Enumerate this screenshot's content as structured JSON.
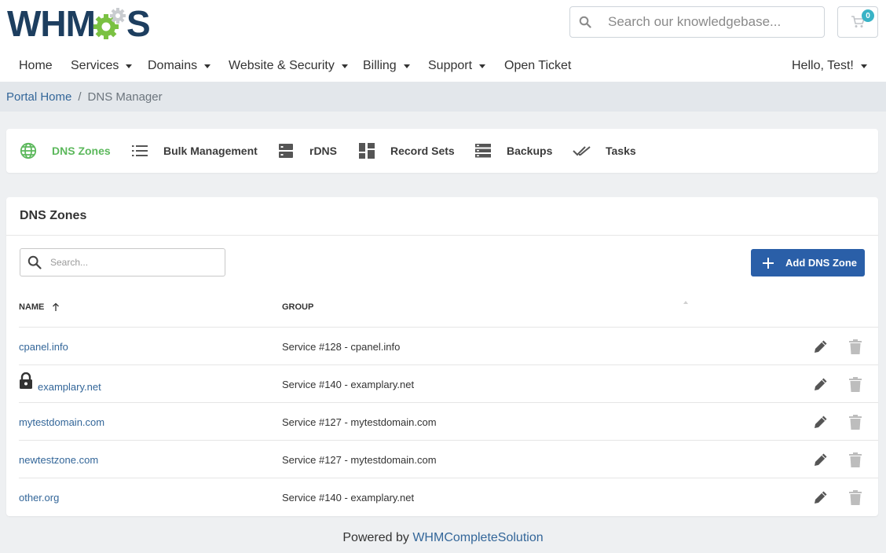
{
  "brand": {
    "logo_text_left": "WHM",
    "logo_text_right": "S",
    "colors": {
      "navy": "#1d3e5f",
      "green": "#7ac142",
      "link": "#336699",
      "primary": "#2a5fa8",
      "active_tab": "#5cb85c",
      "badge": "#39b3c6"
    }
  },
  "header": {
    "search_placeholder": "Search our knowledgebase...",
    "search_icon": "search-icon",
    "cart_icon": "cart-icon",
    "cart_count": "0"
  },
  "nav": {
    "items": [
      {
        "label": "Home",
        "dropdown": false
      },
      {
        "label": "Services",
        "dropdown": true
      },
      {
        "label": "Domains",
        "dropdown": true
      },
      {
        "label": "Website & Security",
        "dropdown": true
      },
      {
        "label": "Billing",
        "dropdown": true
      },
      {
        "label": "Support",
        "dropdown": true
      },
      {
        "label": "Open Ticket",
        "dropdown": false
      }
    ],
    "user_label": "Hello, Test!"
  },
  "breadcrumb": {
    "home": "Portal Home",
    "separator": "/",
    "current": "DNS Manager"
  },
  "tabs": [
    {
      "label": "DNS Zones",
      "icon": "globe-icon",
      "active": true
    },
    {
      "label": "Bulk Management",
      "icon": "list-icon",
      "active": false
    },
    {
      "label": "rDNS",
      "icon": "server-icon",
      "active": false
    },
    {
      "label": "Record Sets",
      "icon": "grid-icon",
      "active": false
    },
    {
      "label": "Backups",
      "icon": "stack-icon",
      "active": false
    },
    {
      "label": "Tasks",
      "icon": "double-check-icon",
      "active": false
    }
  ],
  "zones_card": {
    "title": "DNS Zones",
    "search_placeholder": "Search...",
    "add_button": "Add DNS Zone",
    "columns": {
      "name": "NAME",
      "group": "GROUP"
    },
    "rows": [
      {
        "name": "cpanel.info",
        "group": "Service #128 - cpanel.info",
        "locked": false
      },
      {
        "name": "examplary.net",
        "group": "Service #140 - examplary.net",
        "locked": true
      },
      {
        "name": "mytestdomain.com",
        "group": "Service #127 - mytestdomain.com",
        "locked": false
      },
      {
        "name": "newtestzone.com",
        "group": "Service #127 - mytestdomain.com",
        "locked": false
      },
      {
        "name": "other.org",
        "group": "Service #140 - examplary.net",
        "locked": false
      }
    ]
  },
  "footer": {
    "prefix": "Powered by",
    "link": "WHMCompleteSolution"
  }
}
